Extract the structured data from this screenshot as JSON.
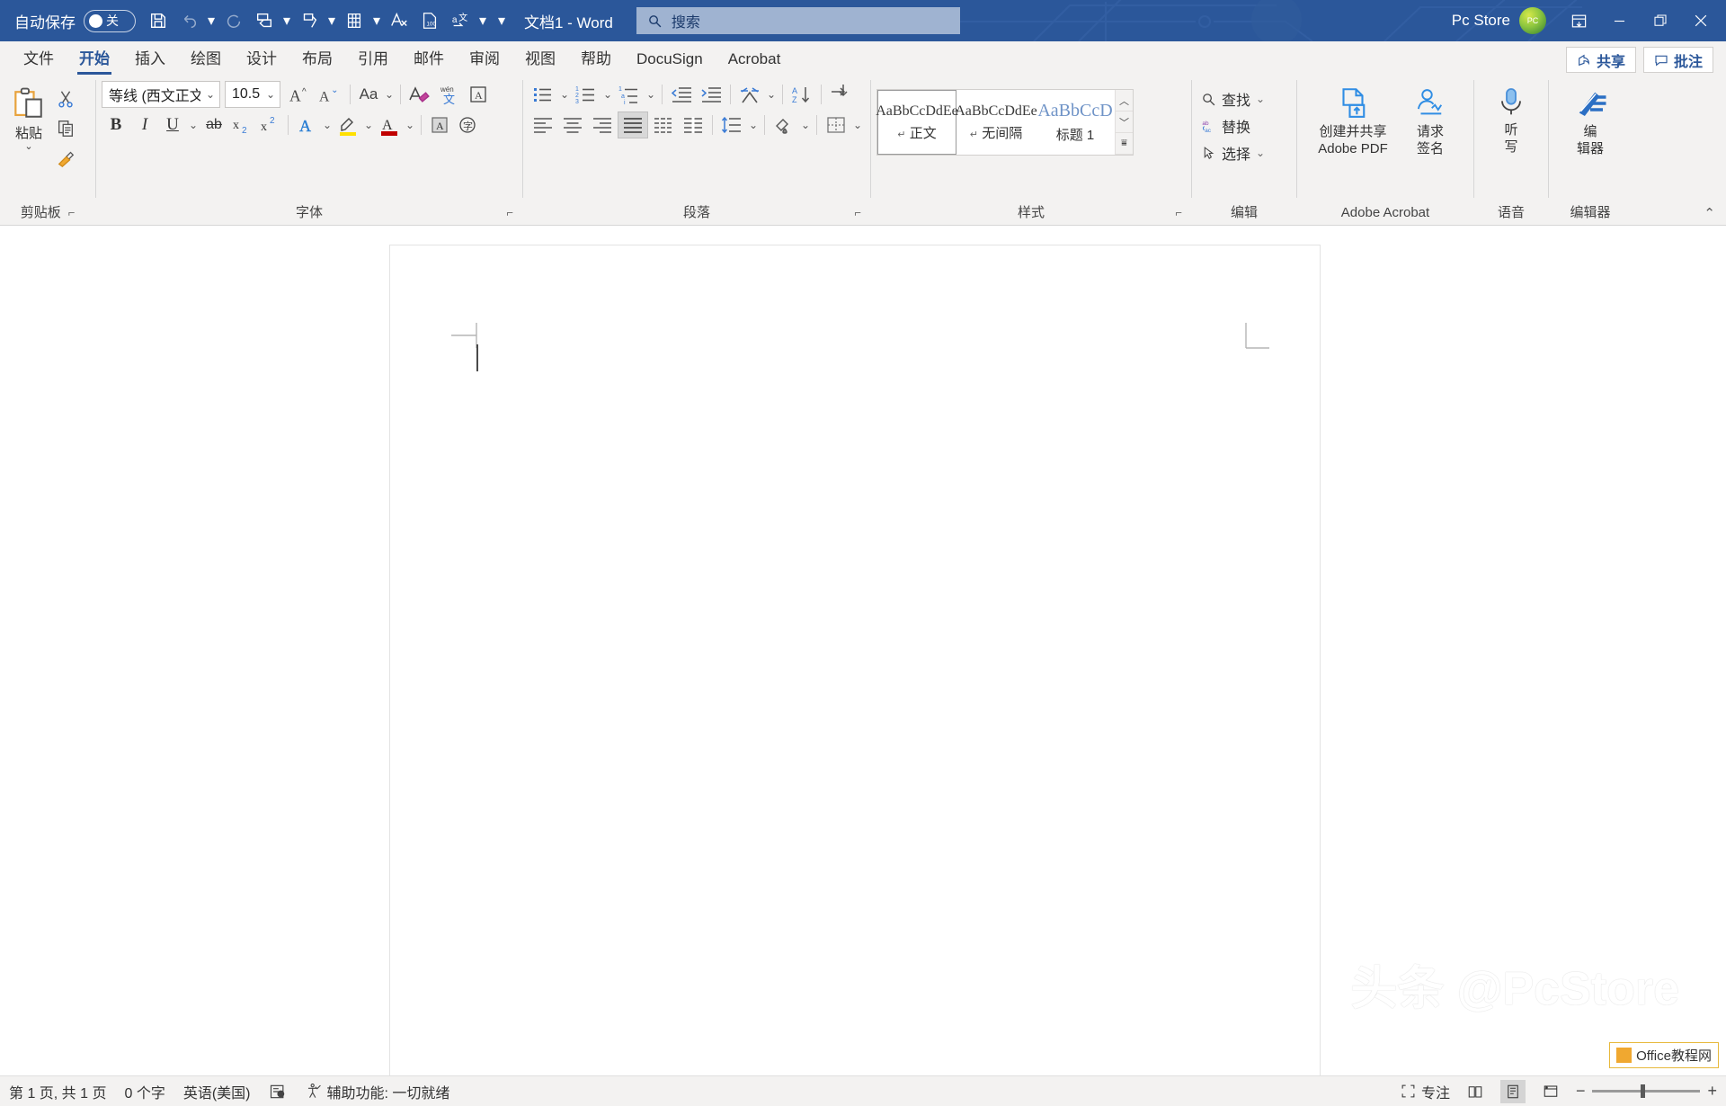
{
  "titlebar": {
    "autosave_label": "自动保存",
    "autosave_state": "关",
    "document_title": "文档1  -  Word",
    "search_placeholder": "搜索",
    "account_name": "Pc Store",
    "qat": [
      {
        "name": "save",
        "label": "保存"
      },
      {
        "name": "undo",
        "label": "撤消"
      },
      {
        "name": "redo",
        "label": "恢复"
      },
      {
        "name": "print-preview",
        "label": "打印预览和打印"
      },
      {
        "name": "format-painter-qat",
        "label": "格式刷"
      },
      {
        "name": "table",
        "label": "表格"
      },
      {
        "name": "clear-formatting-qat",
        "label": "清除格式"
      },
      {
        "name": "word-count",
        "label": "字数统计"
      },
      {
        "name": "translate",
        "label": "翻译"
      }
    ],
    "window_buttons": [
      {
        "name": "ribbon-display-options",
        "label": "功能区显示选项"
      },
      {
        "name": "minimize",
        "label": "最小化"
      },
      {
        "name": "restore",
        "label": "向下还原"
      },
      {
        "name": "close",
        "label": "关闭"
      }
    ]
  },
  "tabs": [
    {
      "label": "文件",
      "active": false
    },
    {
      "label": "开始",
      "active": true
    },
    {
      "label": "插入",
      "active": false
    },
    {
      "label": "绘图",
      "active": false
    },
    {
      "label": "设计",
      "active": false
    },
    {
      "label": "布局",
      "active": false
    },
    {
      "label": "引用",
      "active": false
    },
    {
      "label": "邮件",
      "active": false
    },
    {
      "label": "审阅",
      "active": false
    },
    {
      "label": "视图",
      "active": false
    },
    {
      "label": "帮助",
      "active": false
    },
    {
      "label": "DocuSign",
      "active": false
    },
    {
      "label": "Acrobat",
      "active": false
    }
  ],
  "tab_right": {
    "share_label": "共享",
    "comments_label": "批注"
  },
  "ribbon": {
    "clipboard": {
      "group_label": "剪贴板",
      "paste_label": "粘贴",
      "cut_label": "剪切",
      "copy_label": "复制",
      "format_painter_label": "格式刷"
    },
    "font": {
      "group_label": "字体",
      "font_name": "等线 (西文正文)",
      "font_size": "10.5",
      "buttons": [
        {
          "name": "grow-font",
          "label": "增大字号"
        },
        {
          "name": "shrink-font",
          "label": "减小字号"
        },
        {
          "name": "change-case",
          "label": "Aa"
        },
        {
          "name": "clear-formatting",
          "label": "清除所有格式"
        },
        {
          "name": "phonetic-guide",
          "label": "拼音指南"
        },
        {
          "name": "character-border",
          "label": "字符边框"
        },
        {
          "name": "bold",
          "label": "B"
        },
        {
          "name": "italic",
          "label": "I"
        },
        {
          "name": "underline",
          "label": "U"
        },
        {
          "name": "strikethrough",
          "label": "ab"
        },
        {
          "name": "subscript",
          "label": "x₂"
        },
        {
          "name": "superscript",
          "label": "x²"
        },
        {
          "name": "text-effects",
          "label": "文本效果和版式"
        },
        {
          "name": "text-highlight-color",
          "label": "文本突出显示颜色"
        },
        {
          "name": "font-color",
          "label": "字体颜色"
        },
        {
          "name": "character-shading",
          "label": "字符底纹"
        },
        {
          "name": "enclose-characters",
          "label": "带圈字符"
        }
      ]
    },
    "paragraph": {
      "group_label": "段落",
      "buttons": [
        {
          "name": "bullets",
          "label": "项目符号"
        },
        {
          "name": "numbering",
          "label": "编号"
        },
        {
          "name": "multilevel-list",
          "label": "多级列表"
        },
        {
          "name": "decrease-indent",
          "label": "减少缩进量"
        },
        {
          "name": "increase-indent",
          "label": "增加缩进量"
        },
        {
          "name": "sort-paragraph",
          "label": "中文版式"
        },
        {
          "name": "sort",
          "label": "排序"
        },
        {
          "name": "show-formatting-marks",
          "label": "显示编辑标记"
        },
        {
          "name": "align-left",
          "label": "左对齐"
        },
        {
          "name": "align-center",
          "label": "居中"
        },
        {
          "name": "align-right",
          "label": "右对齐"
        },
        {
          "name": "justify",
          "label": "两端对齐"
        },
        {
          "name": "distribute",
          "label": "分散对齐"
        },
        {
          "name": "line-spacing",
          "label": "行和段落间距"
        },
        {
          "name": "shading",
          "label": "底纹"
        },
        {
          "name": "borders",
          "label": "边框"
        }
      ]
    },
    "styles": {
      "group_label": "样式",
      "items": [
        {
          "preview": "AaBbCcDdEe",
          "label": "正文",
          "mark": "↵",
          "selected": true,
          "heading": false
        },
        {
          "preview": "AaBbCcDdEe",
          "label": "无间隔",
          "mark": "↵",
          "selected": false,
          "heading": false
        },
        {
          "preview": "AaBbCcD",
          "label": "标题 1",
          "mark": "",
          "selected": false,
          "heading": true
        }
      ],
      "scroll": [
        "︿",
        "﹀",
        "⩸"
      ]
    },
    "editing": {
      "group_label": "编辑",
      "find_label": "查找",
      "replace_label": "替换",
      "select_label": "选择"
    },
    "adobe": {
      "group_label": "Adobe Acrobat",
      "create_share_label_line1": "创建并共享",
      "create_share_label_line2": "Adobe PDF",
      "request_sign_line1": "请求",
      "request_sign_line2": "签名"
    },
    "voice": {
      "group_label": "语音",
      "dictate_line1": "听",
      "dictate_line2": "写"
    },
    "editor": {
      "group_label": "编辑器",
      "editor_line1": "编",
      "editor_line2": "辑器"
    },
    "collapse_label": "折叠功能区"
  },
  "document": {
    "watermark_text": "头条 @PcStore",
    "badge_text": "Office教程网"
  },
  "statusbar": {
    "page_info": "第 1 页, 共 1 页",
    "word_count": "0 个字",
    "language": "英语(美国)",
    "proofing_label": "校对",
    "accessibility": "辅助功能: 一切就绪",
    "focus_label": "专注",
    "views": [
      {
        "name": "read-mode",
        "label": "阅读视图",
        "active": false
      },
      {
        "name": "print-layout",
        "label": "页面视图",
        "active": true
      },
      {
        "name": "web-layout",
        "label": "Web 版式视图",
        "active": false
      }
    ],
    "zoom_out_label": "缩小",
    "zoom_in_label": "放大"
  },
  "colors": {
    "titlebar": "#2b579a",
    "accent": "#2b579a",
    "ribbon_bg": "#f3f2f1"
  }
}
